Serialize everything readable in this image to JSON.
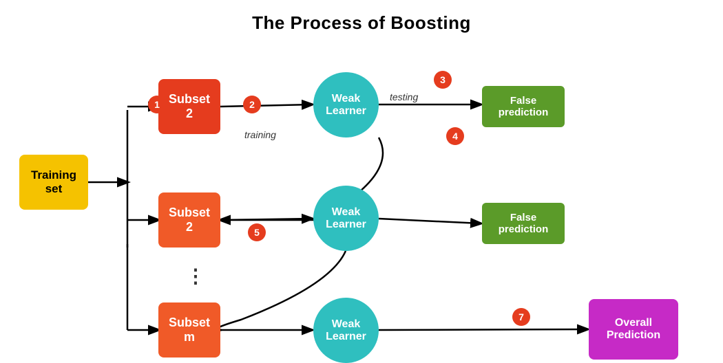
{
  "title": "The Process of Boosting",
  "training_set": {
    "label": "Training\nset"
  },
  "subsets": [
    {
      "label": "Subset\n2",
      "id": "subset1"
    },
    {
      "label": "Subset\n2",
      "id": "subset2"
    },
    {
      "label": "Subset\nm",
      "id": "subset3"
    }
  ],
  "weak_learners": [
    {
      "label": "Weak\nLearner",
      "id": "wl1"
    },
    {
      "label": "Weak\nLearner",
      "id": "wl2"
    },
    {
      "label": "Weak\nLearner",
      "id": "wl3"
    }
  ],
  "false_predictions": [
    {
      "label": "False\nprediction",
      "id": "fp1"
    },
    {
      "label": "False\nprediction",
      "id": "fp2"
    }
  ],
  "overall_prediction": {
    "label": "Overall\nPrediction"
  },
  "badges": [
    "1",
    "2",
    "3",
    "4",
    "5",
    "7"
  ],
  "labels": {
    "training": "training",
    "testing": "testing"
  },
  "ellipsis": "⋮"
}
